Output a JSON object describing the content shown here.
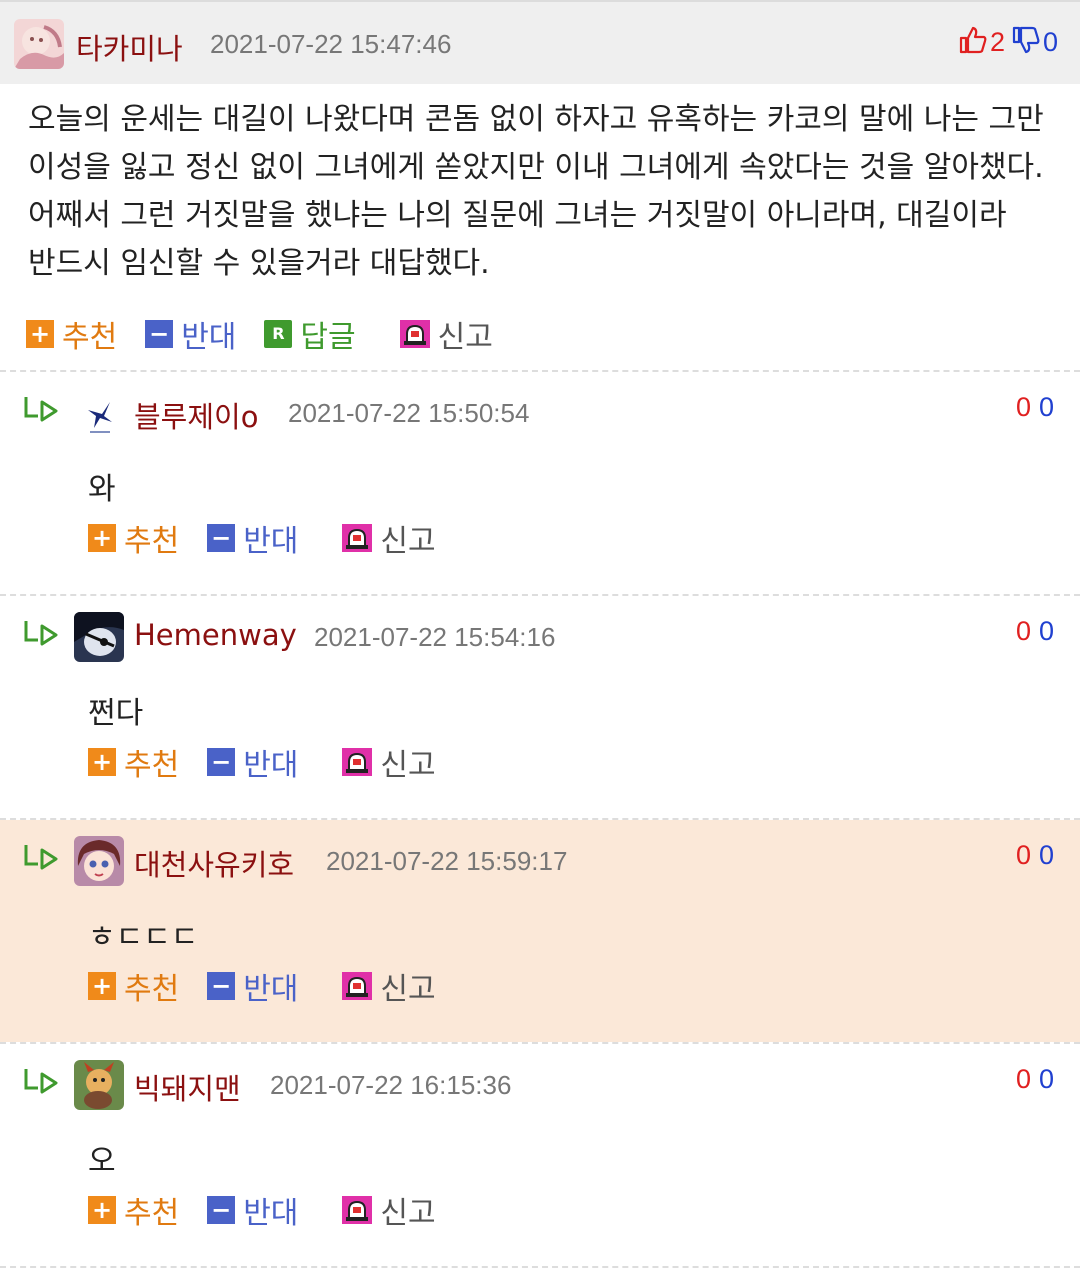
{
  "post": {
    "author": "타카미나",
    "date": "2021-07-22 15:47:46",
    "votes": {
      "up": "2",
      "down": "0"
    },
    "body": "오늘의 운세는 대길이 나왔다며 콘돔 없이 하자고 유혹하는 카코의 말에 나는 그만 이성을 잃고 정신 없이 그녀에게 쏟았지만 이내 그녀에게 속았다는 것을 알아챘다. 어째서 그런 거짓말을 했냐는 나의 질문에 그녀는 거짓말이 아니라며, 대길이라 반드시 임신할 수 있을거라 대답했다.",
    "actions": {
      "recommend": "추천",
      "oppose": "반대",
      "reply": "답글",
      "report": "신고"
    }
  },
  "comment_actions": {
    "recommend": "추천",
    "oppose": "반대",
    "report": "신고"
  },
  "comments": [
    {
      "author": "블루제이o",
      "date": "2021-07-22 15:50:54",
      "up": "0",
      "down": "0",
      "text": "와"
    },
    {
      "author": "Hemenway",
      "date": "2021-07-22 15:54:16",
      "up": "0",
      "down": "0",
      "text": "쩐다"
    },
    {
      "author": "대천사유키호",
      "date": "2021-07-22 15:59:17",
      "up": "0",
      "down": "0",
      "text": "ㅎㄷㄷㄷ"
    },
    {
      "author": "빅돼지맨",
      "date": "2021-07-22 16:15:36",
      "up": "0",
      "down": "0",
      "text": "오"
    }
  ],
  "colors": {
    "nickname": "#8b1010",
    "recommend": "#f08a1a",
    "oppose": "#4a62c8",
    "reply": "#3f9a2e",
    "report": "#e030a8",
    "highlight_bg": "#fbe8d8"
  }
}
